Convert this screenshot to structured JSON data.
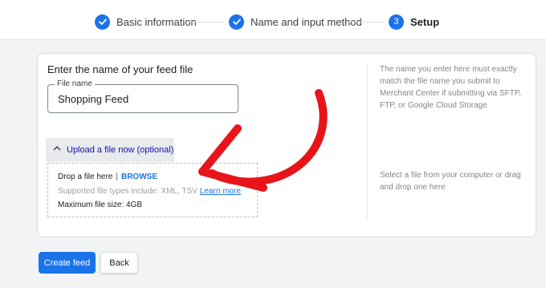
{
  "stepper": {
    "steps": [
      {
        "label": "Basic information",
        "state": "done"
      },
      {
        "label": "Name and input method",
        "state": "done"
      },
      {
        "label": "Setup",
        "number": "3",
        "state": "active"
      }
    ]
  },
  "feed_file": {
    "heading": "Enter the name of your feed file",
    "field_label": "File name",
    "field_value": "Shopping Feed",
    "help": "The name you enter here must exactly match the file name you submit to Merchant Center if submitting via SFTP, FTP, or Google Cloud Storage"
  },
  "upload": {
    "toggle_label": "Upload a file now (optional)",
    "drop_text": "Drop a file here",
    "separator": "|",
    "browse_label": "BROWSE",
    "supported_text": "Supported file types include: XML, TSV",
    "learn_more_label": "Learn more",
    "max_size_text": "Maximum file size: 4GB",
    "help": "Select a file from your computer or drag and drop one here"
  },
  "actions": {
    "create_label": "Create feed",
    "back_label": "Back"
  },
  "colors": {
    "accent": "#1a73e8",
    "annotation": "#e8141a"
  }
}
